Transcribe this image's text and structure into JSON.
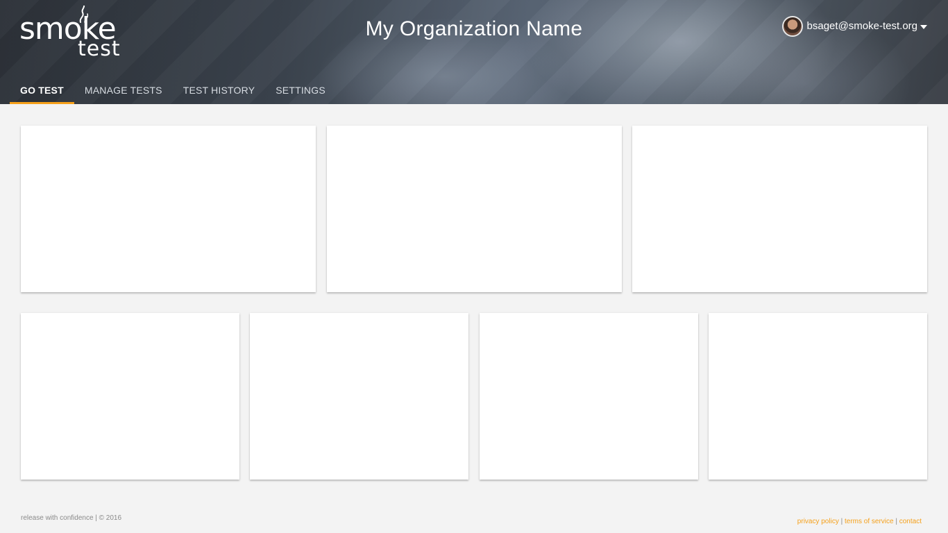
{
  "header": {
    "logo": {
      "top": "smoke",
      "bottom": "test"
    },
    "org_name": "My Organization Name",
    "user": {
      "email": "bsaget@smoke-test.org"
    }
  },
  "tabs": [
    {
      "label": "GO TEST",
      "active": true
    },
    {
      "label": "MANAGE TESTS",
      "active": false
    },
    {
      "label": "TEST HISTORY",
      "active": false
    },
    {
      "label": "SETTINGS",
      "active": false
    }
  ],
  "footer": {
    "tagline": "release with confidence | © 2016",
    "links": [
      "privacy policy",
      "terms of service",
      "contact"
    ],
    "separator": "|"
  },
  "colors": {
    "accent": "#f5a01a",
    "background": "#f3f3f3",
    "card": "#ffffff"
  }
}
